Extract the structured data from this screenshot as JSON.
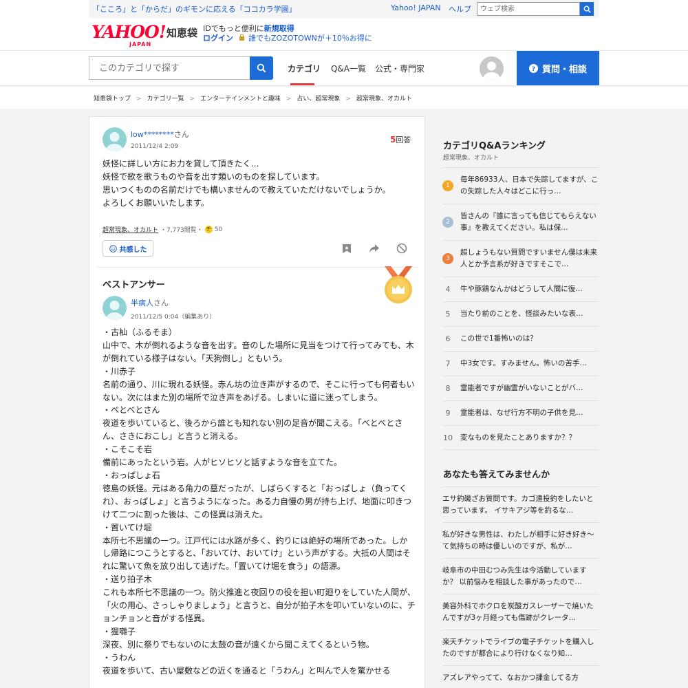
{
  "topbar": {
    "promo": "「こころ」と「からだ」のギモンに応える「ココカラ学園」",
    "yahoo_link": "Yahoo! JAPAN",
    "help_link": "ヘルプ",
    "web_search_placeholder": "ウェブ検索"
  },
  "header": {
    "logo": "YAHOO!",
    "logo_sub": "JAPAN",
    "service_name": "知恵袋",
    "login_line1_prefix": "IDでもっと便利に",
    "login_line1_link": "新規取得",
    "login_link": "ログイン",
    "login_promo": "誰でもZOZOTOWNが＋10％お得に"
  },
  "nav": {
    "search_placeholder": "このカテゴリで探す",
    "items": [
      "カテゴリ",
      "Q&A一覧",
      "公式・専門家"
    ],
    "ask_button": "質問・相談"
  },
  "breadcrumb": [
    "知恵袋トップ",
    "カテゴリ一覧",
    "エンターテインメントと趣味",
    "占い、超常現象",
    "超常現象、オカルト"
  ],
  "question": {
    "user": "low********",
    "san": "さん",
    "date": "2011/12/4 2:09",
    "answer_count": "5",
    "answer_label": "回答",
    "body": "妖怪に詳しい方にお力を貸して頂きたく…\n妖怪で歌を歌うものや音を出す類いのものを探しています。\n思いつくものの名前だけでも構いませんので教えていただけないでしょうか。\nよろしくお願いいたします。",
    "category": "超常現象、オカルト",
    "views": "・7,773閲覧・",
    "coin_label": "チ",
    "coins": "50",
    "empathy_label": "共感した"
  },
  "best_answer": {
    "title": "ベストアンサー",
    "user": "半病人",
    "san": "さん",
    "date": "2011/12/5 0:04（編集あり）",
    "body": "・古杣（ふるそま）\n山中で、木が倒れるような音を出す。音のした場所に見当をつけて行ってみても、木が倒れている様子はない。「天狗倒し」ともいう。\n・川赤子\n名前の通り、川に現れる妖怪。赤ん坊の泣き声がするので、そこに行っても何者もいない。次にはまた別の場所で泣き声をあげる。しまいに道に迷ってしまう。\n・べとべとさん\n夜道を歩いていると、後ろから誰とも知れない別の足音が聞こえる。「べとべとさん、さきにおこし」と言うと消える。\n・こそこそ岩\n備前にあったという岩。人がヒソヒソと話すような音を立てた。\n・おっぱしょ石\n徳島の妖怪。元はある角力の墓だったが、しばらくすると「おっぱしょ（負ってくれ）、おっぱしょ」と言うようになった。ある力自慢の男が持ち上げ、地面に叩きつけて二つに割った後は、この怪異は消えた。\n・置いてけ堀\n本所七不思議の一つ。江戸代には水路が多く、釣りには絶好の場所であった。しかし帰路につこうとすると、「おいてけ、おいてけ」という声がする。大抵の人間はそれに驚いて魚を放り出して逃げた。「置いてけ堀を食う」の語源。\n・送り拍子木\nこれも本所七不思議の一つ。防火推進と夜回りの役を担い町廻りをしていた人間が、「火の用心、さっしゃりましょう」と言うと、自分が拍子木を叩いていないのに、チョンチョンと音がする怪異。\n・狸囃子\n深夜、別に祭りでもないのに太鼓の音が遠くから聞こえてくるという物。\n・うわん\n夜道を歩いて、古い屋敷などの近くを通ると「うわん」と叫んで人を驚かせる"
  },
  "ranking": {
    "title": "カテゴリQ&Aランキング",
    "subtitle": "超常現象、オカルト",
    "items": [
      {
        "num": "1",
        "text": "毎年86933人、日本で失踪してますが、この失踪した人々はどこに行っ…"
      },
      {
        "num": "2",
        "text": "皆さんの『誰に言っても信じてもらえない事』を教えてください。私は保…"
      },
      {
        "num": "3",
        "text": "超しょうもない質問ですいません僕は未来人とか予言系が好きですそこで…"
      },
      {
        "num": "4",
        "text": "牛や豚鶏なんかはどうして人間に復…"
      },
      {
        "num": "5",
        "text": "当たり前のことを、怪談みたいな表…"
      },
      {
        "num": "6",
        "text": "この世で1番怖いのは？"
      },
      {
        "num": "7",
        "text": "中3女です。すみません。怖いの苦手…"
      },
      {
        "num": "8",
        "text": "霊能者ですが幽霊がいないことがバ…"
      },
      {
        "num": "9",
        "text": "霊能者は、なぜ行方不明の子供を見…"
      },
      {
        "num": "10",
        "text": "変なものを見たことありますか？？"
      }
    ]
  },
  "try_answer": {
    "title": "あなたも答えてみませんか",
    "items": [
      "エサ釣磯ざお質問です。カゴ遠投釣をしたいと思っています。 イサキアジ等を釣るな…",
      "私が好きな男性は、わたしが相手に好き好き〜て気持ちの時は優しいのですが、私が…",
      "岐阜市の中田むつみ先生は今活動していますか？ 以前悩みを相談した事があったので…",
      "美容外科でホクロを炭酸ガスレーザーで焼いたんですが3ヶ月経っても傷跡がクレータ…",
      "楽天チケットでライブの電子チケットを購入したのですが都合により行けなくなり知…",
      "アズレアやってて、なおかつ課金してる方"
    ]
  },
  "colors": {
    "accent_blue": "#1d6bd6",
    "link_blue": "#1a5ccc",
    "brand_red": "#ff0033",
    "rank1": "#f5a623",
    "rank2": "#a9bfd6",
    "rank3": "#ee7d3b"
  }
}
